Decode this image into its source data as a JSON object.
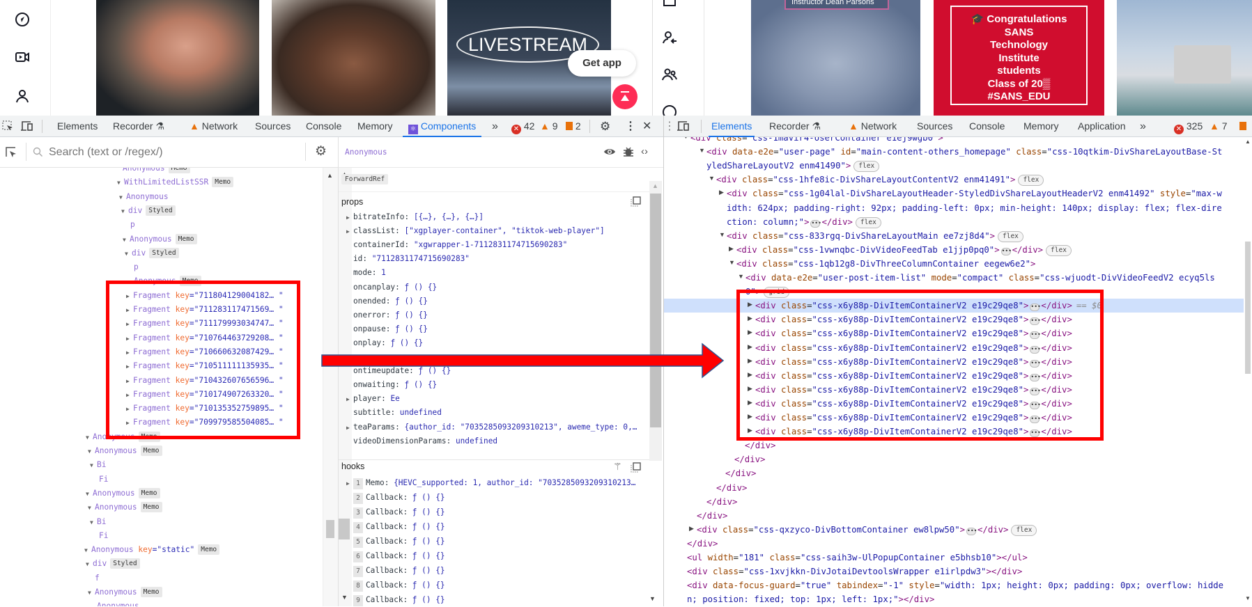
{
  "left_page": {
    "sidebar_icons": [
      "compass-icon",
      "video-camera-icon",
      "profile-icon"
    ],
    "thumbnails": [
      {
        "desc": "man-with-earbuds"
      },
      {
        "desc": "man-closeup"
      },
      {
        "overlay_text": "LIVESTREAM"
      }
    ],
    "get_app_label": "Get app",
    "right_icons": [
      "gift-icon",
      "following-icon",
      "friends-icon",
      "explore-icon"
    ]
  },
  "right_page": {
    "thumbnails": [
      {
        "overlay_text": "Instructor Dean Parsons"
      },
      {
        "lines": [
          "🎓 Congratulations",
          "SANS",
          "Technology",
          "Institute",
          "students",
          "Class of 20▒",
          "#SANS_EDU"
        ]
      },
      {
        "desc": "studio-interview"
      }
    ]
  },
  "left_devtools": {
    "tabs": [
      "Elements",
      "Recorder",
      "Network",
      "Sources",
      "Console",
      "Memory",
      "Components"
    ],
    "active_tab": "Components",
    "more_tabs": "»",
    "errors": "42",
    "warnings": "9",
    "issues": "2",
    "search_placeholder": "Search (text or /regex/)",
    "tree": [
      {
        "name": "Anonymous",
        "badge": "Memo",
        "arrow": ""
      },
      {
        "name": "WithLimitedListSSR",
        "badge": "Memo",
        "arrow": "down"
      },
      {
        "name": "Anonymous",
        "arrow": "down"
      },
      {
        "name": "div",
        "badge": "Styled",
        "arrow": "down"
      },
      {
        "name": "p",
        "arrow": ""
      },
      {
        "name": "Anonymous",
        "badge": "Memo",
        "arrow": "down"
      },
      {
        "name": "div",
        "badge": "Styled",
        "arrow": "down"
      },
      {
        "name": "p",
        "arrow": ""
      },
      {
        "name": "Anonymous",
        "badge": "Memo",
        "arrow": ""
      },
      {
        "name": "Fragment",
        "key": "711804129004182…",
        "arrow": "right"
      },
      {
        "name": "Fragment",
        "key": "711283117471569…",
        "arrow": "right"
      },
      {
        "name": "Fragment",
        "key": "711179993034747…",
        "arrow": "right"
      },
      {
        "name": "Fragment",
        "key": "710764463729208…",
        "arrow": "right"
      },
      {
        "name": "Fragment",
        "key": "710660632087429…",
        "arrow": "right"
      },
      {
        "name": "Fragment",
        "key": "710511111135935…",
        "arrow": "right"
      },
      {
        "name": "Fragment",
        "key": "710432607656596…",
        "arrow": "right"
      },
      {
        "name": "Fragment",
        "key": "710174907263320…",
        "arrow": "right"
      },
      {
        "name": "Fragment",
        "key": "710135352759895…",
        "arrow": "right"
      },
      {
        "name": "Fragment",
        "key": "709979585504085…",
        "arrow": "right"
      },
      {
        "name": "Anonymous",
        "badge": "Memo",
        "arrow": "down"
      },
      {
        "name": "Anonymous",
        "badge": "Memo",
        "arrow": "down"
      },
      {
        "name": "Bi",
        "arrow": "down"
      },
      {
        "name": "Fi",
        "arrow": ""
      },
      {
        "name": "Anonymous",
        "badge": "Memo",
        "arrow": "down"
      },
      {
        "name": "Anonymous",
        "badge": "Memo",
        "arrow": "down"
      },
      {
        "name": "Bi",
        "arrow": "down"
      },
      {
        "name": "Fi",
        "arrow": ""
      },
      {
        "name": "Anonymous",
        "key": "static",
        "badge": "Memo",
        "arrow": "down"
      },
      {
        "name": "div",
        "badge": "Styled",
        "arrow": "down"
      },
      {
        "name": "f",
        "arrow": ""
      },
      {
        "name": "Anonymous",
        "badge": "Memo",
        "arrow": "down"
      },
      {
        "name": "Anonymous",
        "arrow": ""
      }
    ],
    "inspector": {
      "component_name": "Anonymous",
      "wrapper_badge": "ForwardRef",
      "props_label": "props",
      "props": [
        {
          "k": "bitrateInfo",
          "v": "[{…}, {…}, {…}]",
          "expandable": true
        },
        {
          "k": "classList",
          "v": "[\"xgplayer-container\", \"tiktok-web-player\"]",
          "expandable": true
        },
        {
          "k": "containerId",
          "v": "\"xgwrapper-1-7112831174715690283\""
        },
        {
          "k": "id",
          "v": "\"7112831174715690283\""
        },
        {
          "k": "mode",
          "v": "1"
        },
        {
          "k": "oncanplay",
          "v": "ƒ () {}"
        },
        {
          "k": "onended",
          "v": "ƒ () {}"
        },
        {
          "k": "onerror",
          "v": "ƒ () {}"
        },
        {
          "k": "onpause",
          "v": "ƒ () {}"
        },
        {
          "k": "onplay",
          "v": "ƒ () {}"
        },
        {
          "k": "",
          "v": ""
        },
        {
          "k": "ontimeupdate",
          "v": "ƒ () {}"
        },
        {
          "k": "onwaiting",
          "v": "ƒ () {}"
        },
        {
          "k": "player",
          "v": "Ee",
          "expandable": true
        },
        {
          "k": "subtitle",
          "v": "undefined"
        },
        {
          "k": "teaParams",
          "v": "{author_id: \"7035285093209310213\", aweme_type: 0,…",
          "expandable": true
        },
        {
          "k": "videoDimensionParams",
          "v": "undefined"
        }
      ],
      "hooks_label": "hooks",
      "hooks": [
        {
          "n": "1",
          "k": "Memo",
          "v": "{HEVC_supported: 1, author_id: \"7035285093209310213…",
          "expandable": true
        },
        {
          "n": "2",
          "k": "Callback",
          "v": "ƒ () {}"
        },
        {
          "n": "3",
          "k": "Callback",
          "v": "ƒ () {}"
        },
        {
          "n": "4",
          "k": "Callback",
          "v": "ƒ () {}"
        },
        {
          "n": "5",
          "k": "Callback",
          "v": "ƒ () {}"
        },
        {
          "n": "6",
          "k": "Callback",
          "v": "ƒ () {}"
        },
        {
          "n": "7",
          "k": "Callback",
          "v": "ƒ () {}"
        },
        {
          "n": "8",
          "k": "Callback",
          "v": "ƒ () {}"
        },
        {
          "n": "9",
          "k": "Callback",
          "v": "ƒ () {}"
        }
      ]
    }
  },
  "right_devtools": {
    "tabs": [
      "Elements",
      "Recorder",
      "Network",
      "Sources",
      "Console",
      "Memory",
      "Application"
    ],
    "active_tab": "Elements",
    "more_tabs": "»",
    "errors": "325",
    "warnings": "7",
    "selected_marker": "== $0",
    "lines": [
      {
        "open": "<div class=\"css-1mavir4-UserContainer e1ej9wgb0\">",
        "arrow": "down"
      },
      {
        "open": "<div data-e2e=\"user-page\" id=\"main-content-others_homepage\" class=\"css-10qtkim-DivShareLayoutBase-St",
        "arrow": "down"
      },
      {
        "open": "yledShareLayoutV2 enm41490\">",
        "badge": "flex"
      },
      {
        "open": "<div class=\"css-1hfe8ic-DivShareLayoutContentV2 enm41491\">",
        "badge": "flex",
        "arrow": "down"
      },
      {
        "open": "<div class=\"css-1g04lal-DivShareLayoutHeader-StyledDivShareLayoutHeaderV2 enm41492\" style=\"max-w",
        "arrow": "right"
      },
      {
        "open": "idth: 624px; padding-right: 92px; padding-left: 0px; min-height: 140px; display: flex; flex-dire"
      },
      {
        "open": "ction: column;\">",
        "ell": true,
        "close": "</div>",
        "badge": "flex"
      },
      {
        "open": "<div class=\"css-833rgq-DivShareLayoutMain ee7zj8d4\">",
        "badge": "flex",
        "arrow": "down"
      },
      {
        "open": "<div class=\"css-1vwnqbc-DivVideoFeedTab e1jjp0pq0\">",
        "ell": true,
        "close": "</div>",
        "badge": "flex",
        "arrow": "right"
      },
      {
        "open": "<div class=\"css-1qb12g8-DivThreeColumnContainer eegew6e2\">",
        "arrow": "down"
      },
      {
        "open": "<div data-e2e=\"user-post-item-list\" mode=\"compact\" class=\"css-wjuodt-DivVideoFeedV2 ecyq5ls",
        "arrow": "down"
      },
      {
        "open": "0\">",
        "badge": "grid"
      },
      {
        "open": "<div class=\"css-x6y88p-DivItemContainerV2 e19c29qe8\">",
        "ell": true,
        "close": "</div>",
        "arrow": "right",
        "selected": true
      },
      {
        "open": "<div class=\"css-x6y88p-DivItemContainerV2 e19c29qe8\">",
        "ell": true,
        "close": "</div>",
        "arrow": "right"
      },
      {
        "open": "<div class=\"css-x6y88p-DivItemContainerV2 e19c29qe8\">",
        "ell": true,
        "close": "</div>",
        "arrow": "right"
      },
      {
        "open": "<div class=\"css-x6y88p-DivItemContainerV2 e19c29qe8\">",
        "ell": true,
        "close": "</div>",
        "arrow": "right"
      },
      {
        "open": "<div class=\"css-x6y88p-DivItemContainerV2 e19c29qe8\">",
        "ell": true,
        "close": "</div>",
        "arrow": "right"
      },
      {
        "open": "<div class=\"css-x6y88p-DivItemContainerV2 e19c29qe8\">",
        "ell": true,
        "close": "</div>",
        "arrow": "right"
      },
      {
        "open": "<div class=\"css-x6y88p-DivItemContainerV2 e19c29qe8\">",
        "ell": true,
        "close": "</div>",
        "arrow": "right"
      },
      {
        "open": "<div class=\"css-x6y88p-DivItemContainerV2 e19c29qe8\">",
        "ell": true,
        "close": "</div>",
        "arrow": "right"
      },
      {
        "open": "<div class=\"css-x6y88p-DivItemContainerV2 e19c29qe8\">",
        "ell": true,
        "close": "</div>",
        "arrow": "right"
      },
      {
        "open": "<div class=\"css-x6y88p-DivItemContainerV2 e19c29qe8\">",
        "ell": true,
        "close": "</div>",
        "arrow": "right"
      },
      {
        "open": "</div>"
      },
      {
        "open": "</div>"
      },
      {
        "open": "</div>"
      },
      {
        "open": "</div>"
      },
      {
        "open": "</div>"
      },
      {
        "open": "</div>"
      },
      {
        "open": "<div class=\"css-qxzyco-DivBottomContainer ew8lpw50\">",
        "ell": true,
        "close": "</div>",
        "badge": "flex",
        "arrow": "right"
      },
      {
        "open": "</div>"
      },
      {
        "open": "<ul width=\"181\" class=\"css-saih3w-UlPopupContainer e5bhsb10\"></ul>"
      },
      {
        "open": "<div class=\"css-1xvjkkn-DivJotaiDevtoolsWrapper e1irlpdw3\"></div>"
      },
      {
        "open": "<div data-focus-guard=\"true\" tabindex=\"-1\" style=\"width: 1px; height: 0px; padding: 0px; overflow: hidde"
      },
      {
        "open": "n; position: fixed; top: 1px; left: 1px;\"></div>"
      }
    ]
  },
  "annotation": {
    "highlight_color": "#ff0000",
    "arrow_color": "#ff0000"
  },
  "colors": {
    "accent": "#1a73e8",
    "tiktok_red": "#fe2c55",
    "sans_red": "#c8102e"
  }
}
